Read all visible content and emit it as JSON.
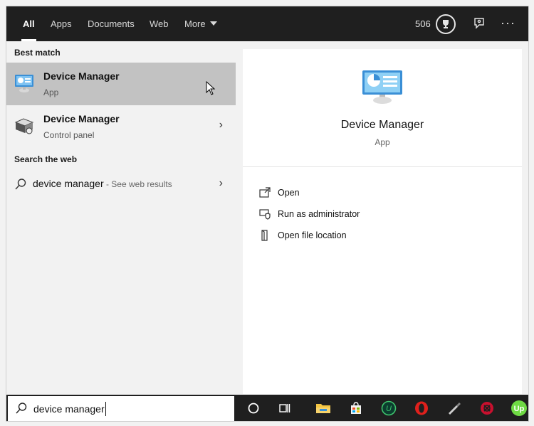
{
  "tabs": [
    {
      "label": "All",
      "active": true
    },
    {
      "label": "Apps"
    },
    {
      "label": "Documents"
    },
    {
      "label": "Web"
    },
    {
      "label": "More"
    }
  ],
  "header_right": {
    "points": "506",
    "trophy_icon": "trophy-icon",
    "feedback_icon": "feedback-icon",
    "more_options": "···"
  },
  "left": {
    "best_match_header": "Best match",
    "results": [
      {
        "title": "Device Manager",
        "subtitle": "App",
        "icon": "device-manager-icon",
        "selected": true
      },
      {
        "title": "Device Manager",
        "subtitle": "Control panel",
        "icon": "control-panel-icon",
        "chevron": "›"
      }
    ],
    "web_header": "Search the web",
    "web_result": {
      "query": "device manager",
      "suffix": " - See web results",
      "chevron": "›"
    }
  },
  "right": {
    "title": "Device Manager",
    "subtitle": "App",
    "actions": [
      {
        "label": "Open",
        "icon": "open-icon"
      },
      {
        "label": "Run as administrator",
        "icon": "shield-icon"
      },
      {
        "label": "Open file location",
        "icon": "file-location-icon"
      }
    ]
  },
  "search": {
    "value": "device manager",
    "icon": "search-icon"
  },
  "taskbar": {
    "items": [
      "cortana-icon",
      "task-view-icon",
      "file-explorer-icon",
      "store-icon",
      "upwork-u-icon",
      "opera-icon",
      "tool-icon",
      "vpn-icon",
      "upwork-up-icon"
    ],
    "upwork_label": "Up"
  },
  "colors": {
    "topbar": "#1f1f1f",
    "selected_row": "#c2c2c2",
    "pane_bg": "#f2f2f2"
  }
}
